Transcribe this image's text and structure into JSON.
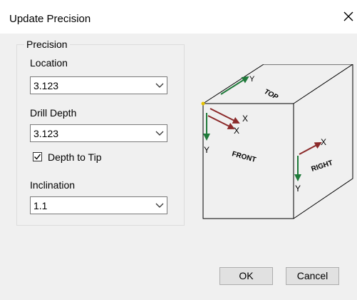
{
  "dialog": {
    "title": "Update Precision",
    "close_icon": "close-icon"
  },
  "precision_group": {
    "label": "Precision",
    "location": {
      "label": "Location",
      "value": "3.123"
    },
    "drill_depth": {
      "label": "Drill Depth",
      "value": "3.123"
    },
    "depth_to_tip": {
      "label": "Depth to Tip",
      "checked": true
    },
    "inclination": {
      "label": "Inclination",
      "value": "1.1"
    }
  },
  "diagram": {
    "labels": {
      "top": "TOP",
      "front": "FRONT",
      "right": "RIGHT",
      "x": "X",
      "y": "Y"
    },
    "colors": {
      "axis_x": "#8b2a2a",
      "axis_y": "#1f7a3a",
      "edge": "#000000"
    }
  },
  "buttons": {
    "ok": "OK",
    "cancel": "Cancel"
  }
}
